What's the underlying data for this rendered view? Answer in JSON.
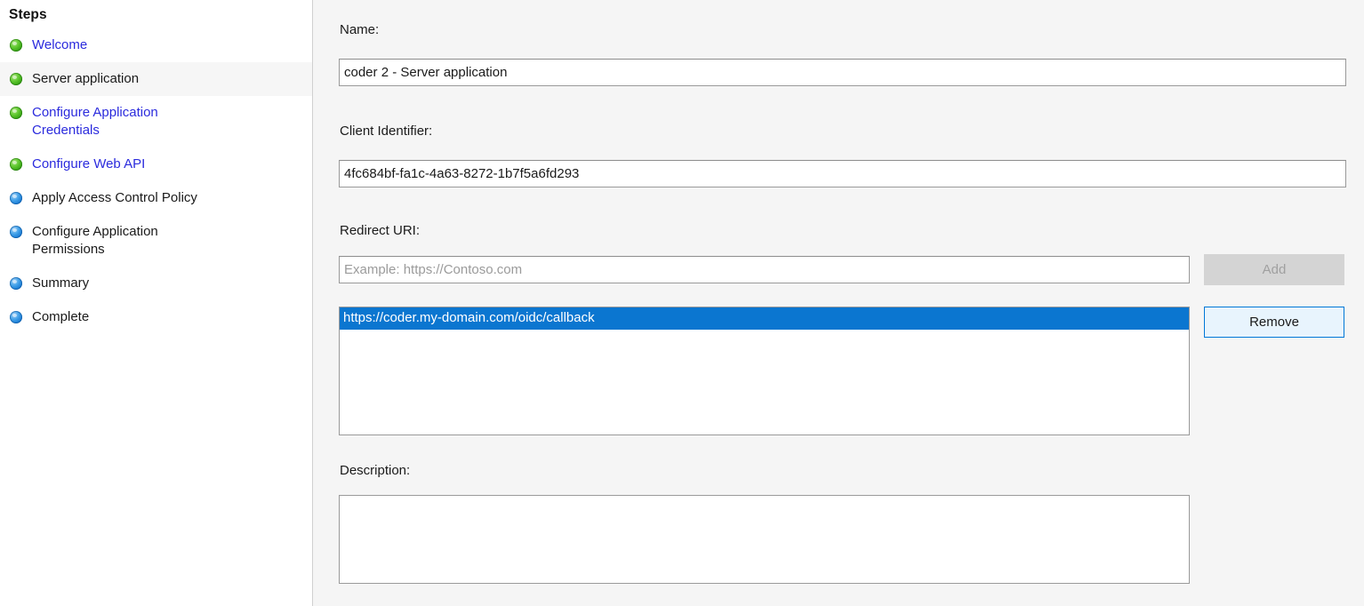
{
  "sidebar": {
    "header": "Steps",
    "items": [
      {
        "label": "Welcome",
        "state": "done",
        "bullet": "green-bullet-icon",
        "style": "link",
        "striped": false
      },
      {
        "label": "Server application",
        "state": "current",
        "bullet": "green-bullet-icon",
        "style": "plain",
        "striped": true
      },
      {
        "label": "Configure Application\nCredentials",
        "state": "done",
        "bullet": "green-bullet-icon",
        "style": "link",
        "striped": false
      },
      {
        "label": "Configure Web API",
        "state": "done",
        "bullet": "green-bullet-icon",
        "style": "link",
        "striped": false
      },
      {
        "label": "Apply Access Control Policy",
        "state": "pending",
        "bullet": "blue-bullet-icon",
        "style": "plain",
        "striped": false
      },
      {
        "label": "Configure Application\nPermissions",
        "state": "pending",
        "bullet": "blue-bullet-icon",
        "style": "plain",
        "striped": false
      },
      {
        "label": "Summary",
        "state": "pending",
        "bullet": "blue-bullet-icon",
        "style": "plain",
        "striped": false
      },
      {
        "label": "Complete",
        "state": "pending",
        "bullet": "blue-bullet-icon",
        "style": "plain",
        "striped": false
      }
    ]
  },
  "form": {
    "name": {
      "label": "Name:",
      "value": "coder 2 - Server application"
    },
    "client_identifier": {
      "label": "Client Identifier:",
      "value": "4fc684bf-fa1c-4a63-8272-1b7f5a6fd293"
    },
    "redirect_uri": {
      "label": "Redirect URI:",
      "value": "",
      "placeholder": "Example: https://Contoso.com",
      "add_button": "Add",
      "add_button_disabled": true,
      "remove_button": "Remove",
      "remove_button_hover": true,
      "entries": [
        {
          "value": "https://coder.my-domain.com/oidc/callback",
          "selected": true
        }
      ]
    },
    "description": {
      "label": "Description:",
      "value": ""
    }
  },
  "colors": {
    "page_background": "#f5f5f5",
    "pane_background": "#ffffff",
    "link_text": "#2b2bdd",
    "body_text": "#1a1a1a",
    "selection_blue": "#0b76d0",
    "bullet_green": "#3caa16",
    "bullet_blue": "#1c7fd6",
    "button_hover_border": "#0078d7",
    "button_hover_fill": "#e8f4fd",
    "button_disabled_fill": "#d4d4d4",
    "button_disabled_text": "#a0a0a0",
    "input_border": "#9a9a9a",
    "placeholder_text": "#9b9b9b",
    "row_stripe": "#f6f6f6"
  }
}
